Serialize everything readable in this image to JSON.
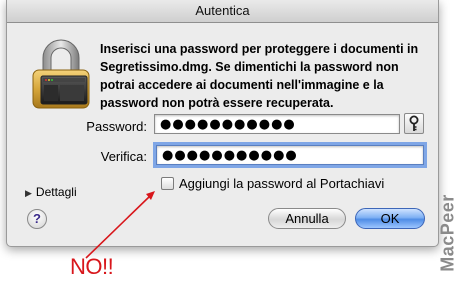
{
  "window": {
    "title": "Autentica"
  },
  "dialog": {
    "message": "Inserisci una password per proteggere i documenti in Segretissimo.dmg.  Se dimentichi la password non potrai accedere ai documenti nell'immagine e la password non potrà essere recuperata.",
    "password_label": "Password:",
    "password_value": "●●●●●●●●●●●",
    "verify_label": "Verifica:",
    "verify_value": "●●●●●●●●●●●",
    "details_label": "Dettagli",
    "keychain_checkbox_label": "Aggiungi la password al Portachiavi",
    "keychain_checked": false,
    "help_label": "?",
    "cancel_label": "Annulla",
    "ok_label": "OK"
  },
  "annotation": {
    "text": "NO!!",
    "color": "#d8161b"
  },
  "watermark": {
    "text": "MacPeer"
  },
  "icons": {
    "lock": "padlock-icon",
    "key": "key-icon",
    "details": "disclosure-triangle-icon",
    "help": "help-icon"
  }
}
